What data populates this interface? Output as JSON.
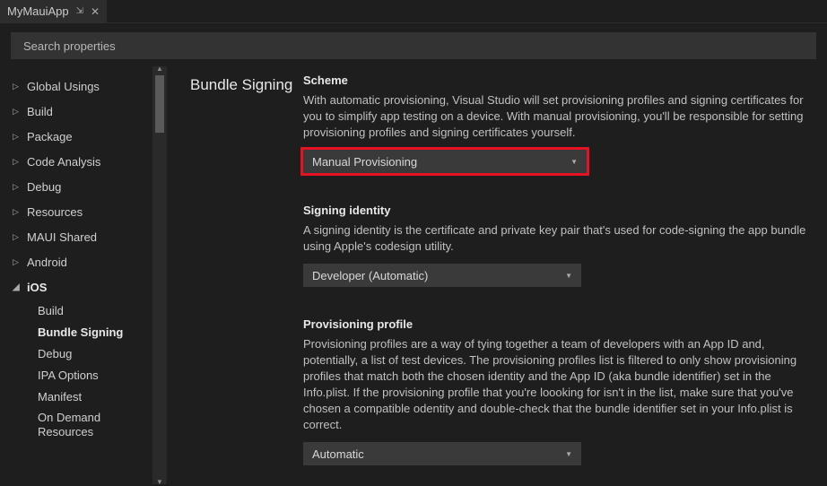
{
  "tab": {
    "title": "MyMauiApp"
  },
  "search": {
    "placeholder": "Search properties"
  },
  "sidebar": {
    "items": [
      {
        "label": "Global Usings"
      },
      {
        "label": "Build"
      },
      {
        "label": "Package"
      },
      {
        "label": "Code Analysis"
      },
      {
        "label": "Debug"
      },
      {
        "label": "Resources"
      },
      {
        "label": "MAUI Shared"
      },
      {
        "label": "Android"
      }
    ],
    "expanded": {
      "label": "iOS",
      "children": [
        {
          "label": "Build"
        },
        {
          "label": "Bundle Signing"
        },
        {
          "label": "Debug"
        },
        {
          "label": "IPA Options"
        },
        {
          "label": "Manifest"
        },
        {
          "label": "On Demand Resources"
        }
      ]
    }
  },
  "section": {
    "title": "Bundle Signing"
  },
  "settings": {
    "scheme": {
      "label": "Scheme",
      "desc": "With automatic provisioning, Visual Studio will set provisioning profiles and signing certificates for you to simplify app testing on a device. With manual provisioning, you'll be responsible for setting provisioning profiles and signing certificates yourself.",
      "value": "Manual Provisioning"
    },
    "identity": {
      "label": "Signing identity",
      "desc": "A signing identity is the certificate and private key pair that's used for code-signing the app bundle using Apple's codesign utility.",
      "value": "Developer (Automatic)"
    },
    "profile": {
      "label": "Provisioning profile",
      "desc": "Provisioning profiles are a way of tying together a team of developers with an App ID and, potentially, a list of test devices. The provisioning profiles list is filtered to only show provisioning profiles that match both the chosen identity and the App ID (aka bundle identifier) set in the Info.plist. If the provisioning profile that you're loooking for isn't in the list, make sure that you've chosen a compatible odentity and double-check that the bundle identifier set in your Info.plist is correct.",
      "value": "Automatic"
    }
  }
}
